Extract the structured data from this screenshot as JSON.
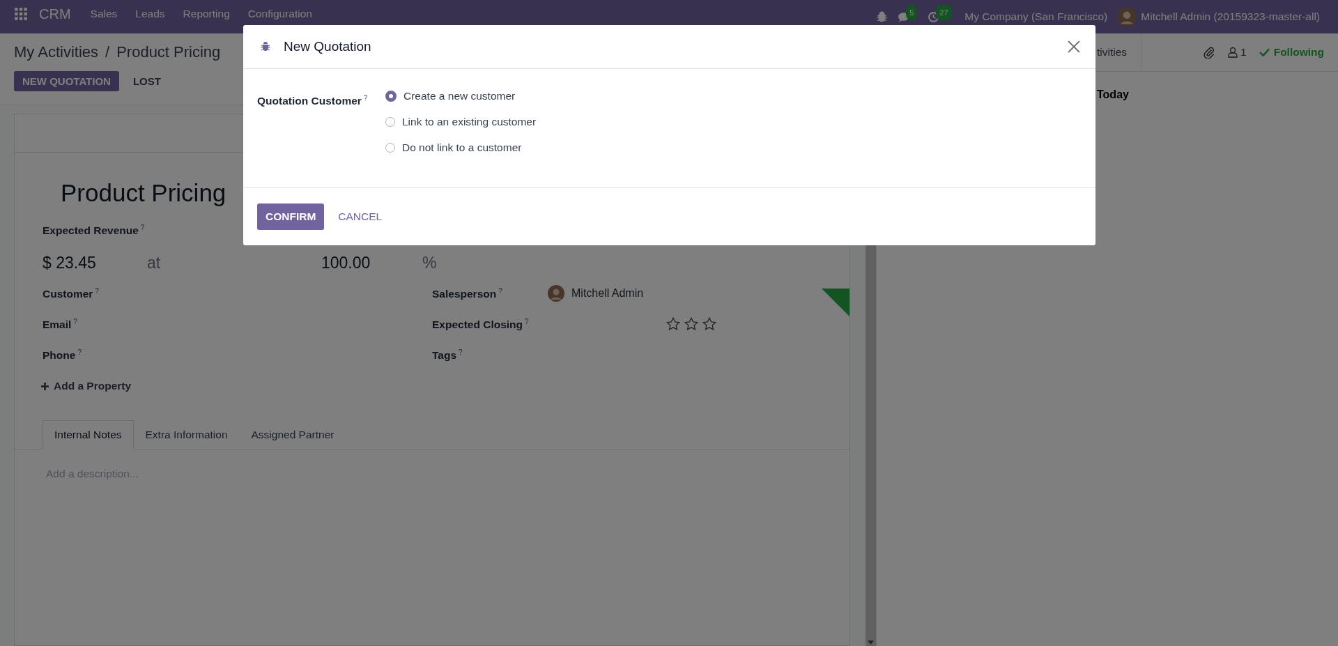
{
  "navbar": {
    "app_name": "CRM",
    "menu": [
      "Sales",
      "Leads",
      "Reporting",
      "Configuration"
    ],
    "messages_badge": "5",
    "activities_badge": "27",
    "company": "My Company (San Francisco)",
    "user": "Mitchell Admin (20159323-master-all)"
  },
  "breadcrumb": [
    "My Activities",
    "/",
    "Product Pricing"
  ],
  "actions": [
    {
      "label": "NEW QUOTATION",
      "kind": "primary"
    },
    {
      "label": "LOST",
      "kind": "secondary"
    }
  ],
  "chatter": {
    "activities_button": "tivities",
    "followers_count": "1",
    "follow_state": "Following",
    "date_heading": "Today"
  },
  "form": {
    "title": "Product Pricing",
    "revenue_label": "Expected Revenue",
    "help_mark": "?",
    "revenue": "$ 23.45",
    "at": "at",
    "probability": "100.00",
    "percent": "%",
    "left_fields": [
      "Customer",
      "Email",
      "Phone"
    ],
    "salesperson_label": "Salesperson",
    "salesperson": "Mitchell Admin",
    "closing_label": "Expected Closing",
    "priority": {
      "stars": 0
    },
    "tags_label": "Tags",
    "add_property": "Add a Property",
    "tabs": [
      {
        "label": "Internal Notes",
        "selected": true
      },
      {
        "label": "Extra Information",
        "selected": false
      },
      {
        "label": "Assigned Partner",
        "selected": false
      }
    ],
    "description_placeholder": "Add a description..."
  },
  "dialog": {
    "title": "New Quotation",
    "field_label": "Quotation Customer",
    "help_mark": "?",
    "options": [
      {
        "label": "Create a new customer",
        "selected": true
      },
      {
        "label": "Link to an existing customer",
        "selected": false
      },
      {
        "label": "Do not link to a customer",
        "selected": false
      }
    ],
    "buttons": [
      {
        "label": "CONFIRM",
        "kind": "primary"
      },
      {
        "label": "CANCEL",
        "kind": "link"
      }
    ]
  }
}
